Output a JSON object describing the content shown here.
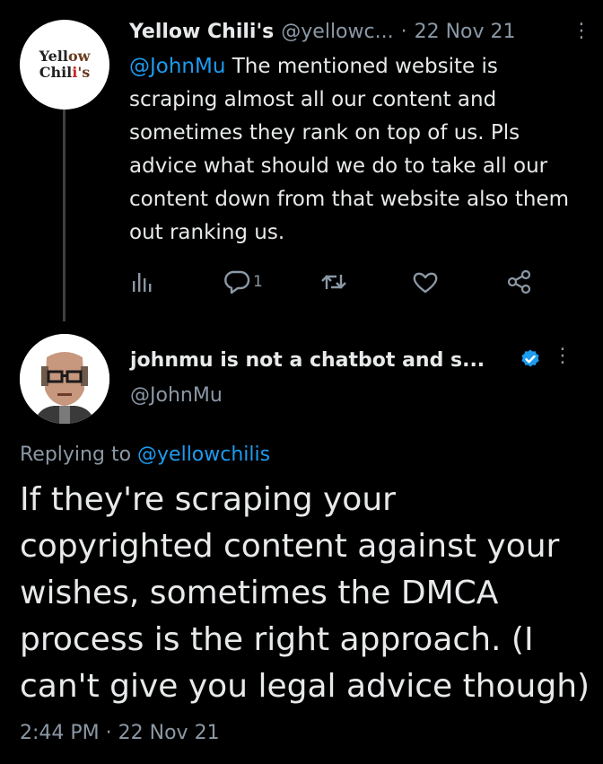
{
  "tweet": {
    "author_name": "Yellow Chili's",
    "author_handle": "@yellowc...",
    "separator": "·",
    "date": "22 Nov 21",
    "more_icon": "⋮",
    "avatar_text_line1": "Yellow",
    "avatar_text_line2": "Chili's",
    "mention": "@JohnMu",
    "body": " The mentioned website is scraping almost all our content and sometimes they rank on top of us. Pls advice what should we do to take all our content down from that website also them out ranking us.",
    "actions": {
      "analytics_icon": "bar-chart-icon",
      "reply_icon": "reply-icon",
      "reply_count": "1",
      "retweet_icon": "retweet-icon",
      "like_icon": "heart-icon",
      "share_icon": "share-icon"
    }
  },
  "reply": {
    "author_name": "johnmu is not a chatbot and s...",
    "author_handle": "@JohnMu",
    "more_icon": "⋮",
    "replying_prefix": "Replying to ",
    "replying_to": "@yellowchilis",
    "text": "If they're scraping your copyrighted content against your wishes, sometimes the DMCA process is the right approach. (I can't give you legal advice though)",
    "time": "2:44 PM",
    "separator": "·",
    "date": "22 Nov 21"
  },
  "colors": {
    "background": "#000000",
    "text": "#e7e9ea",
    "secondary": "#8b98a5",
    "link": "#1d9bf0",
    "thread_line": "#3e4144"
  }
}
